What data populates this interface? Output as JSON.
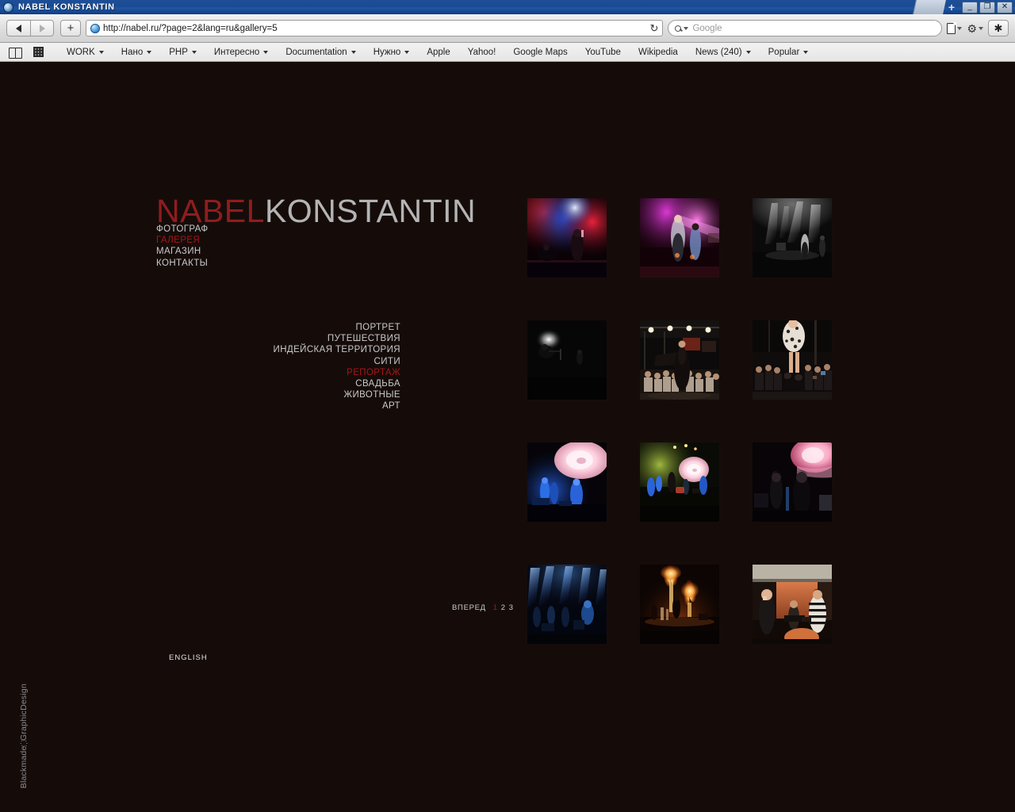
{
  "window": {
    "title": "NABEL KONSTANTIN",
    "minimize_label": "_",
    "restore_label": "❐",
    "close_label": "✕",
    "new_tab_label": "+"
  },
  "toolbar": {
    "back_label": "Back",
    "forward_label": "Forward",
    "add_bookmark_label": "+",
    "url": "http://nabel.ru/?page=2&lang=ru&gallery=5",
    "reload_label": "↻",
    "search_placeholder": "Google",
    "page_menu_label": "Page",
    "settings_label": "Settings",
    "bug_label": "✱"
  },
  "bookmarks": {
    "show_all_label": "Show All Bookmarks",
    "top_sites_label": "Top Sites",
    "items": [
      {
        "label": "WORK",
        "menu": true
      },
      {
        "label": "Нано",
        "menu": true
      },
      {
        "label": "PHP",
        "menu": true
      },
      {
        "label": "Интересно",
        "menu": true
      },
      {
        "label": "Documentation",
        "menu": true
      },
      {
        "label": "Нужно",
        "menu": true
      },
      {
        "label": "Apple",
        "menu": false
      },
      {
        "label": "Yahoo!",
        "menu": false
      },
      {
        "label": "Google Maps",
        "menu": false
      },
      {
        "label": "YouTube",
        "menu": false
      },
      {
        "label": "Wikipedia",
        "menu": false
      },
      {
        "label": "News (240)",
        "menu": true
      },
      {
        "label": "Popular",
        "menu": true
      }
    ]
  },
  "site": {
    "colors": {
      "background": "#150c0a",
      "accent_red": "#a81515",
      "logo_red": "#8f1d1d",
      "text_gray": "#c9c9c9"
    },
    "logo": {
      "first": "NABEL",
      "second": "KONSTANTIN"
    },
    "main_nav": [
      {
        "label": "ФОТОГРАФ",
        "active": false
      },
      {
        "label": "ГАЛЕРЕЯ",
        "active": true
      },
      {
        "label": "МАГАЗИН",
        "active": false
      },
      {
        "label": "КОНТАКТЫ",
        "active": false
      }
    ],
    "categories": [
      {
        "label": "ПОРТРЕТ",
        "active": false
      },
      {
        "label": "ПУТЕШЕСТВИЯ",
        "active": false
      },
      {
        "label": "ИНДЕЙСКАЯ ТЕРРИТОРИЯ",
        "active": false
      },
      {
        "label": "СИТИ",
        "active": false
      },
      {
        "label": "РЕПОРТАЖ",
        "active": true
      },
      {
        "label": "СВАДЬБА",
        "active": false
      },
      {
        "label": "ЖИВОТНЫЕ",
        "active": false
      },
      {
        "label": "АРТ",
        "active": false
      }
    ],
    "pager": {
      "next_label": "ВПЕРЕД",
      "pages": [
        {
          "label": "1",
          "current": true
        },
        {
          "label": "2",
          "current": false
        },
        {
          "label": "3",
          "current": false
        }
      ]
    },
    "language_link": "ENGLISH",
    "credit": "Blackmade ҉ GraphicDesign",
    "gallery": {
      "thumbnails": [
        {
          "id": "thumb-1",
          "caption": "Concert — red and blue stage lights, singer with drummer"
        },
        {
          "id": "thumb-2",
          "caption": "Concert — magenta lit singer with band"
        },
        {
          "id": "thumb-3",
          "caption": "Concert — black and white stage with spotlights"
        },
        {
          "id": "thumb-4",
          "caption": "Concert — dark stage, single white spotlight on musician"
        },
        {
          "id": "thumb-5",
          "caption": "Fashion show — model on runway with crowd"
        },
        {
          "id": "thumb-6",
          "caption": "Fashion show — model in patterned dress, photographers"
        },
        {
          "id": "thumb-7",
          "caption": "Concert — blue lit performers with white rose projection"
        },
        {
          "id": "thumb-8",
          "caption": "Concert — green haze stage with rose projection"
        },
        {
          "id": "thumb-9",
          "caption": "Concert — two performers in front of pink rose projection"
        },
        {
          "id": "thumb-10",
          "caption": "Concert — blue beam lights over band on stage"
        },
        {
          "id": "thumb-11",
          "caption": "Concert — flame jets erupting on stage"
        },
        {
          "id": "thumb-12",
          "caption": "Concert — band indoors with orange backdrop"
        }
      ]
    }
  }
}
